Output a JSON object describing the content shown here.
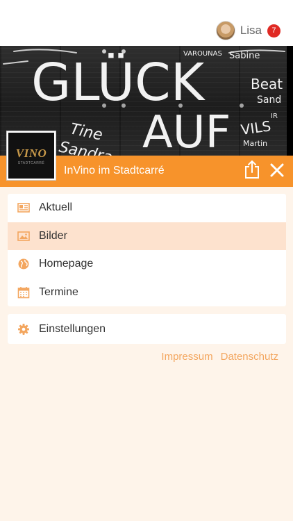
{
  "user": {
    "name": "Lisa",
    "notifications": "7"
  },
  "hero": {
    "chalk_words": [
      "GLÜCK",
      "AUF",
      "Tine",
      "Sandra",
      "Beat",
      "Sand",
      "VILS",
      "Martin",
      "Sabine",
      "IR",
      "VAROUNAS"
    ]
  },
  "logo": {
    "text": "VINO",
    "sub": "STADTCARRÉ"
  },
  "place": {
    "title": "InVino im Stadtcarré"
  },
  "menu": {
    "items": [
      {
        "label": "Aktuell",
        "icon": "newspaper-icon",
        "active": false
      },
      {
        "label": "Bilder",
        "icon": "image-icon",
        "active": true
      },
      {
        "label": "Homepage",
        "icon": "globe-icon",
        "active": false
      },
      {
        "label": "Termine",
        "icon": "calendar-icon",
        "active": false
      }
    ],
    "settings_label": "Einstellungen"
  },
  "footer": {
    "impressum": "Impressum",
    "datenschutz": "Datenschutz"
  },
  "colors": {
    "accent": "#f7932b",
    "active_row": "#fde2ce",
    "background": "#fef4ea",
    "icon": "#f3a65f",
    "badge": "#e02a24"
  }
}
